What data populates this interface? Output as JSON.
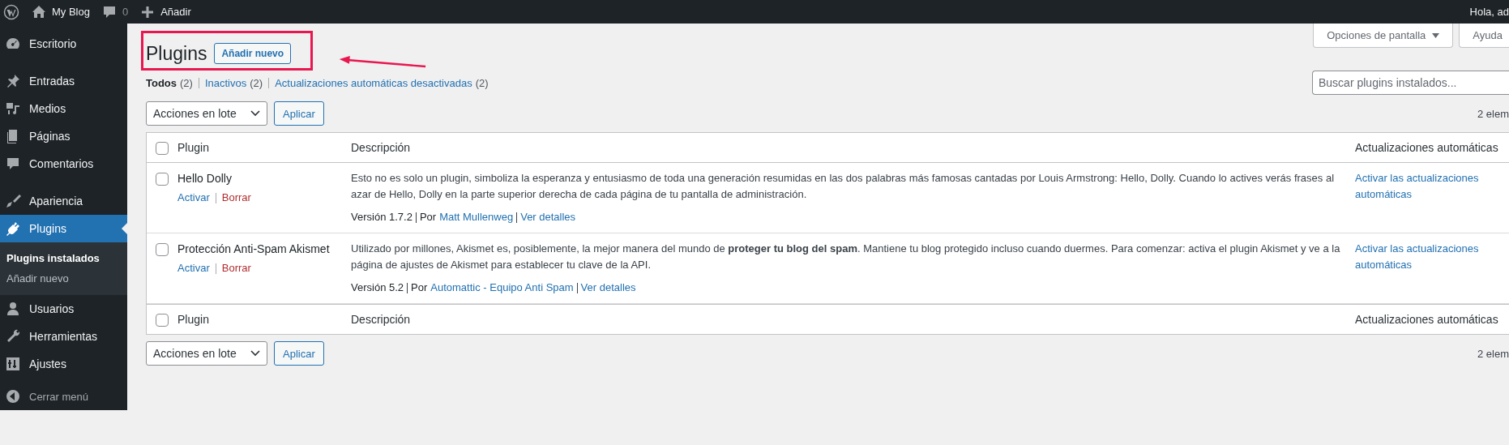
{
  "admin_bar": {
    "site": "My Blog",
    "comments": "0",
    "new": "Añadir",
    "greeting": "Hola, ad"
  },
  "sidebar": {
    "items": [
      {
        "kind": "dashboard",
        "label": "Escritorio",
        "selected": false
      },
      {
        "kind": "pin",
        "label": "Entradas",
        "selected": false
      },
      {
        "kind": "media",
        "label": "Medios",
        "selected": false
      },
      {
        "kind": "pages",
        "label": "Páginas",
        "selected": false
      },
      {
        "kind": "comment",
        "label": "Comentarios",
        "selected": false
      },
      {
        "kind": "brush",
        "label": "Apariencia",
        "selected": false
      },
      {
        "kind": "plug",
        "label": "Plugins",
        "selected": true,
        "children": [
          {
            "label": "Plugins instalados",
            "selected": true
          },
          {
            "label": "Añadir nuevo",
            "selected": false
          }
        ]
      },
      {
        "kind": "user",
        "label": "Usuarios",
        "selected": false
      },
      {
        "kind": "wrench",
        "label": "Herramientas",
        "selected": false
      },
      {
        "kind": "sliders",
        "label": "Ajustes",
        "selected": false
      }
    ],
    "collapse": "Cerrar menú"
  },
  "screen_tabs": [
    {
      "label": "Opciones de pantalla",
      "caret": true
    },
    {
      "label": "Ayuda",
      "caret": false
    }
  ],
  "heading": {
    "title": "Plugins",
    "add_button": "Añadir nuevo"
  },
  "filters": [
    {
      "label": "Todos",
      "count": "(2)",
      "selected": true
    },
    {
      "label": "Inactivos",
      "count": "(2)",
      "selected": false
    },
    {
      "label": "Actualizaciones automáticas desactivadas",
      "count": "(2)",
      "selected": false
    }
  ],
  "search": {
    "placeholder": "Buscar plugins instalados..."
  },
  "bulk_top": {
    "select": "Acciones en lote",
    "apply": "Aplicar",
    "count": "2 elem"
  },
  "table": {
    "columns": [
      "Plugin",
      "Descripción",
      "Actualizaciones automáticas"
    ],
    "rows": [
      {
        "name": "Hello Dolly",
        "checked": false,
        "active": false,
        "actions": [
          {
            "label": "Activar",
            "kind": "activate"
          },
          {
            "label": "Borrar",
            "kind": "delete"
          }
        ],
        "description": "Esto no es solo un plugin, simboliza la esperanza y entusiasmo de toda una generación resumidas en las dos palabras más famosas cantadas por Louis Armstrong: Hello, Dolly. Cuando lo actives verás frases al azar de Hello, Dolly en la parte superior derecha de cada página de tu pantalla de administración.",
        "version": "Versión 1.7.2",
        "by": "Por",
        "author": "Matt Mullenweg",
        "details": "Ver detalles",
        "auto_update": "Activar las actualizaciones automáticas"
      },
      {
        "name": "Protección Anti-Spam Akismet",
        "checked": false,
        "active": false,
        "actions": [
          {
            "label": "Activar",
            "kind": "activate"
          },
          {
            "label": "Borrar",
            "kind": "delete"
          }
        ],
        "description": "Utilizado por millones, Akismet es, posiblemente, la mejor manera del mundo de **proteger tu blog del spam**. Mantiene tu blog protegido incluso cuando duermes. Para comenzar: activa el plugin Akismet y ve a la página de ajustes de Akismet para establecer tu clave de la API.",
        "version": "Versión 5.2",
        "by": "Por",
        "author": "Automattic - Equipo Anti Spam",
        "details": "Ver detalles",
        "auto_update": "Activar las actualizaciones automáticas"
      }
    ],
    "footer_columns": [
      "Plugin",
      "Descripción",
      "Actualizaciones automáticas"
    ],
    "header_checked": false,
    "footer_checked": false
  },
  "bulk_bottom": {
    "select": "Acciones en lote",
    "apply": "Aplicar",
    "count": "2 elem"
  }
}
